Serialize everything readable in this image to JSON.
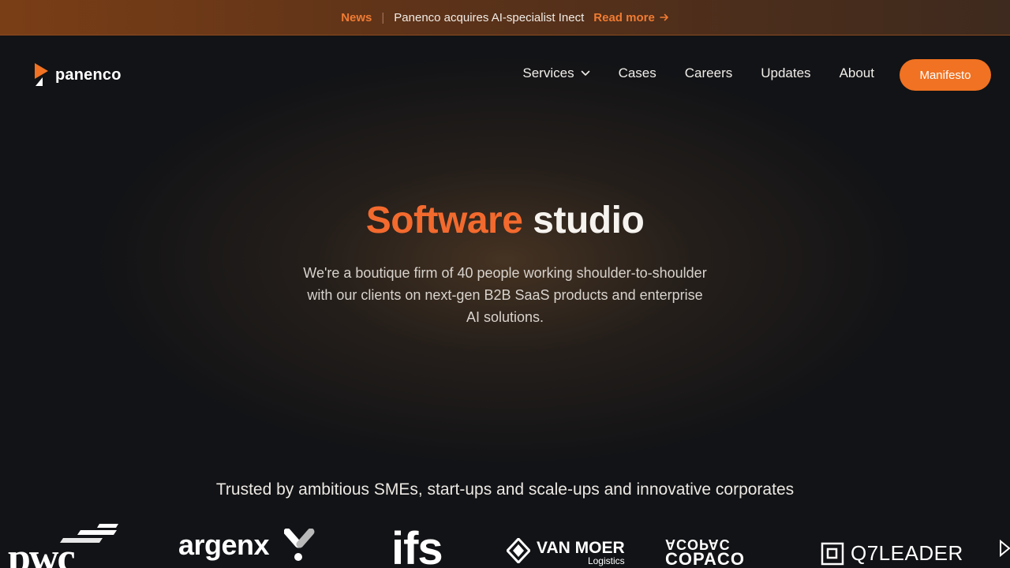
{
  "announcement": {
    "tag": "News",
    "separator": "|",
    "message": "Panenco acquires AI-specialist Inect",
    "link": "Read more"
  },
  "nav": {
    "logo_text": "panenco",
    "items": [
      "Services",
      "Cases",
      "Careers",
      "Updates",
      "About"
    ],
    "cta": "Manifesto"
  },
  "hero": {
    "title_accent": "Software",
    "title_rest": "studio",
    "subtitle": "We're a boutique firm of 40 people working shoulder-to-shoulder with our clients on next-gen B2B SaaS products and enterprise AI solutions."
  },
  "trusted": {
    "text": "Trusted by ambitious SMEs, start-ups and scale-ups and innovative corporates",
    "logos": {
      "pwc": "pwc",
      "argenx": "argenx",
      "ifs": "ifs",
      "vanmoer": "VAN MOER",
      "vanmoer_sub": "Logistics",
      "copaco_top": "ACOPAC",
      "copaco": "COPACO",
      "q7leader": "Q7LEADER"
    }
  },
  "colors": {
    "accent": "#f07222",
    "background": "#121316",
    "announce_bg": "#7a3e16"
  },
  "icons": [
    "arrow-right-icon",
    "chevron-down-icon",
    "logo-mark-icon",
    "carousel-next-icon"
  ]
}
